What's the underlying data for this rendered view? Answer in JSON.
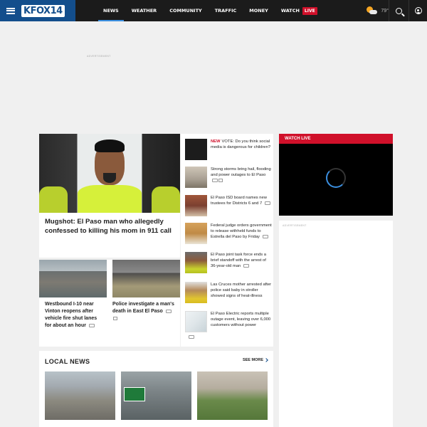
{
  "header": {
    "logo": "KFOX14",
    "nav": [
      {
        "label": "NEWS",
        "active": true
      },
      {
        "label": "WEATHER"
      },
      {
        "label": "COMMUNITY"
      },
      {
        "label": "TRAFFIC"
      },
      {
        "label": "MONEY"
      },
      {
        "label": "WATCH",
        "badge": "LIVE"
      }
    ],
    "weather": {
      "temp": "79°",
      "icon": "partly-sunny-icon"
    },
    "icons": {
      "menu": "hamburger-icon",
      "search": "search-icon",
      "user": "user-icon"
    }
  },
  "ads": {
    "label": "ADVERTISEMENT"
  },
  "hero": {
    "title": "Mugshot: El Paso man who allegedly confessed to killing his mom in 911 call"
  },
  "small_stories": [
    {
      "title": "Westbound I-10 near Vinton reopens after vehicle fire shut lanes for about an hour"
    },
    {
      "title": "Police investigate a man's death in East El Paso"
    }
  ],
  "side_stories": [
    {
      "tag": "NEW",
      "title": "VOTE: Do you think social media is dangerous for children?"
    },
    {
      "title": "Strong storms bring hail, flooding and power outages to El Paso"
    },
    {
      "title": "El Paso ISD board names new trustees for Districts 6 and 7"
    },
    {
      "title": "Federal judge orders government to release withheld funds to Estrella del Paso by Friday"
    },
    {
      "title": "El Paso joint task force ends a brief standoff with the arrest of 36-year-old man"
    },
    {
      "title": "Las Cruces mother arrested after police said baby in stroller showed signs of heat-illness"
    },
    {
      "title": "El Paso Electric reports multiple outage event, leaving over 6,000 customers without power"
    }
  ],
  "local_news": {
    "title": "LOCAL NEWS",
    "see_more": "SEE MORE"
  },
  "watch_live": {
    "label": "WATCH LIVE"
  },
  "colors": {
    "brand": "#134e8c",
    "accent": "#d0102a",
    "header_bg": "#1b1b1b"
  }
}
